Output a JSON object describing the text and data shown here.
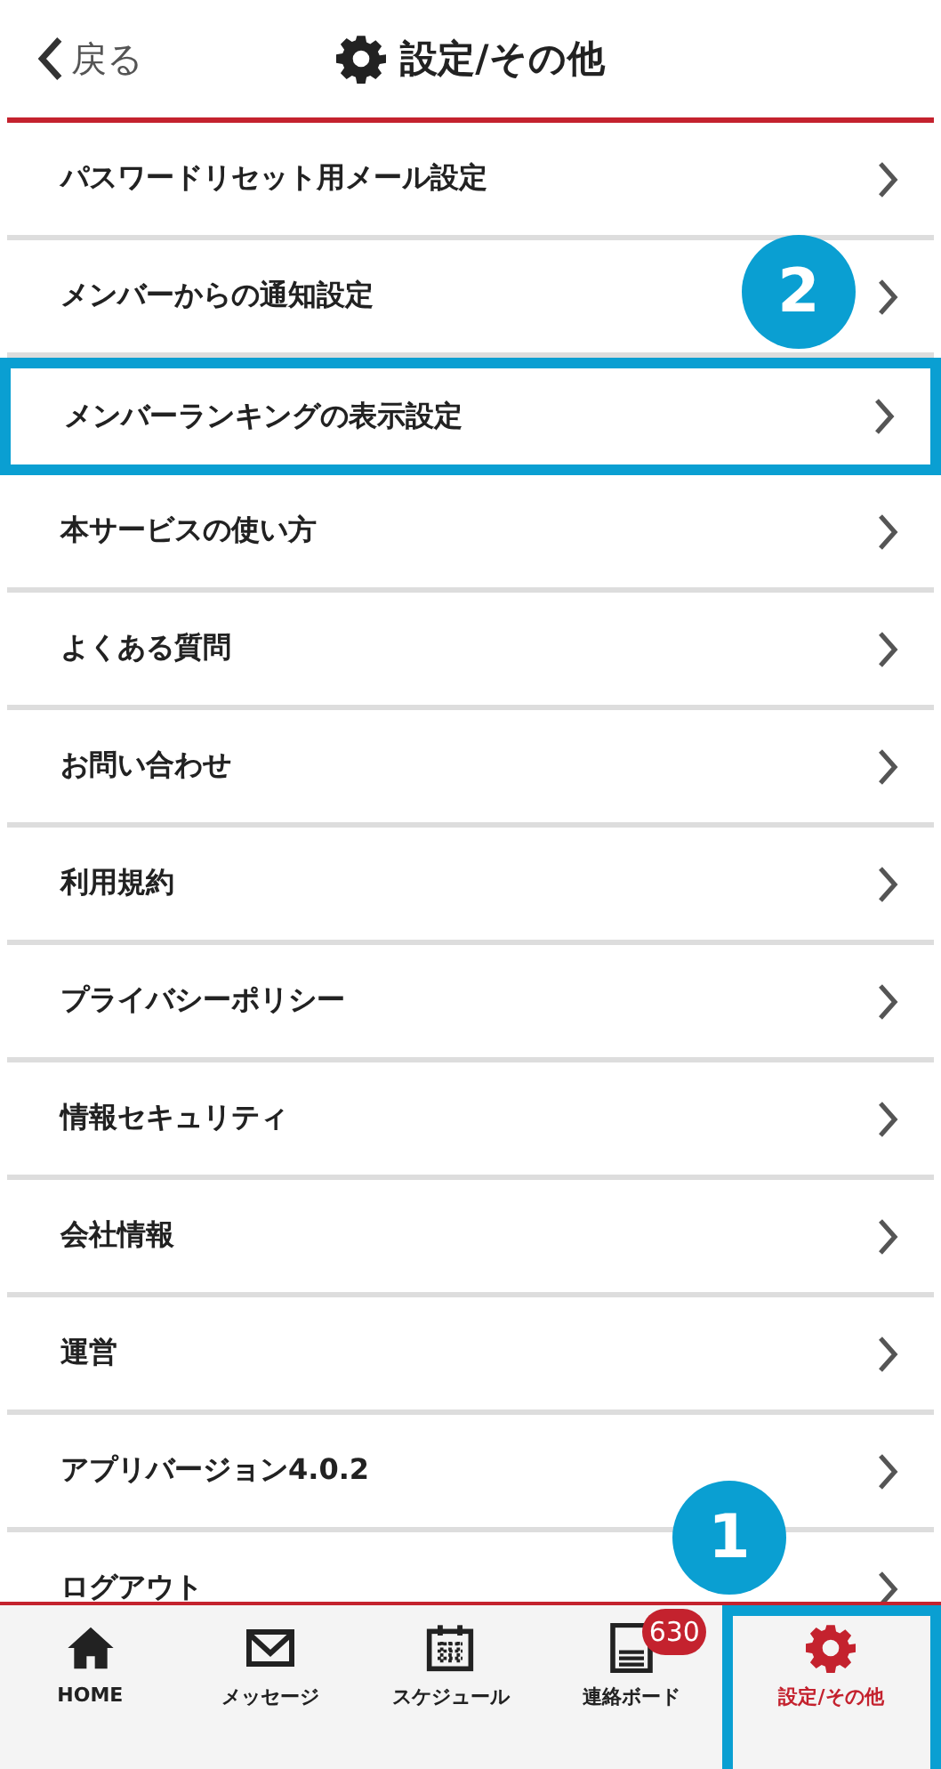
{
  "header": {
    "back": "戻る",
    "title": "設定/その他"
  },
  "menu": [
    {
      "label": "パスワードリセット用メール設定",
      "highlighted": false
    },
    {
      "label": "メンバーからの通知設定",
      "highlighted": false
    },
    {
      "label": "メンバーランキングの表示設定",
      "highlighted": true,
      "callout": "2"
    },
    {
      "label": "本サービスの使い方",
      "highlighted": false
    },
    {
      "label": "よくある質問",
      "highlighted": false
    },
    {
      "label": "お問い合わせ",
      "highlighted": false
    },
    {
      "label": "利用規約",
      "highlighted": false
    },
    {
      "label": "プライバシーポリシー",
      "highlighted": false
    },
    {
      "label": "情報セキュリティ",
      "highlighted": false
    },
    {
      "label": "会社情報",
      "highlighted": false
    },
    {
      "label": "運営",
      "highlighted": false
    },
    {
      "label": "アプリバージョン4.0.2",
      "highlighted": false
    },
    {
      "label": "ログアウト",
      "highlighted": false
    }
  ],
  "tabs": [
    {
      "kind": "home",
      "label": "HOME",
      "selected": false,
      "highlighted": false
    },
    {
      "kind": "mail",
      "label": "メッセージ",
      "selected": false,
      "highlighted": false
    },
    {
      "kind": "calendar",
      "label": "スケジュール",
      "selected": false,
      "highlighted": false
    },
    {
      "kind": "board",
      "label": "連絡ボード",
      "selected": false,
      "highlighted": false,
      "badge": "630"
    },
    {
      "kind": "gear",
      "label": "設定/その他",
      "selected": true,
      "highlighted": true,
      "callout": "1"
    }
  ]
}
